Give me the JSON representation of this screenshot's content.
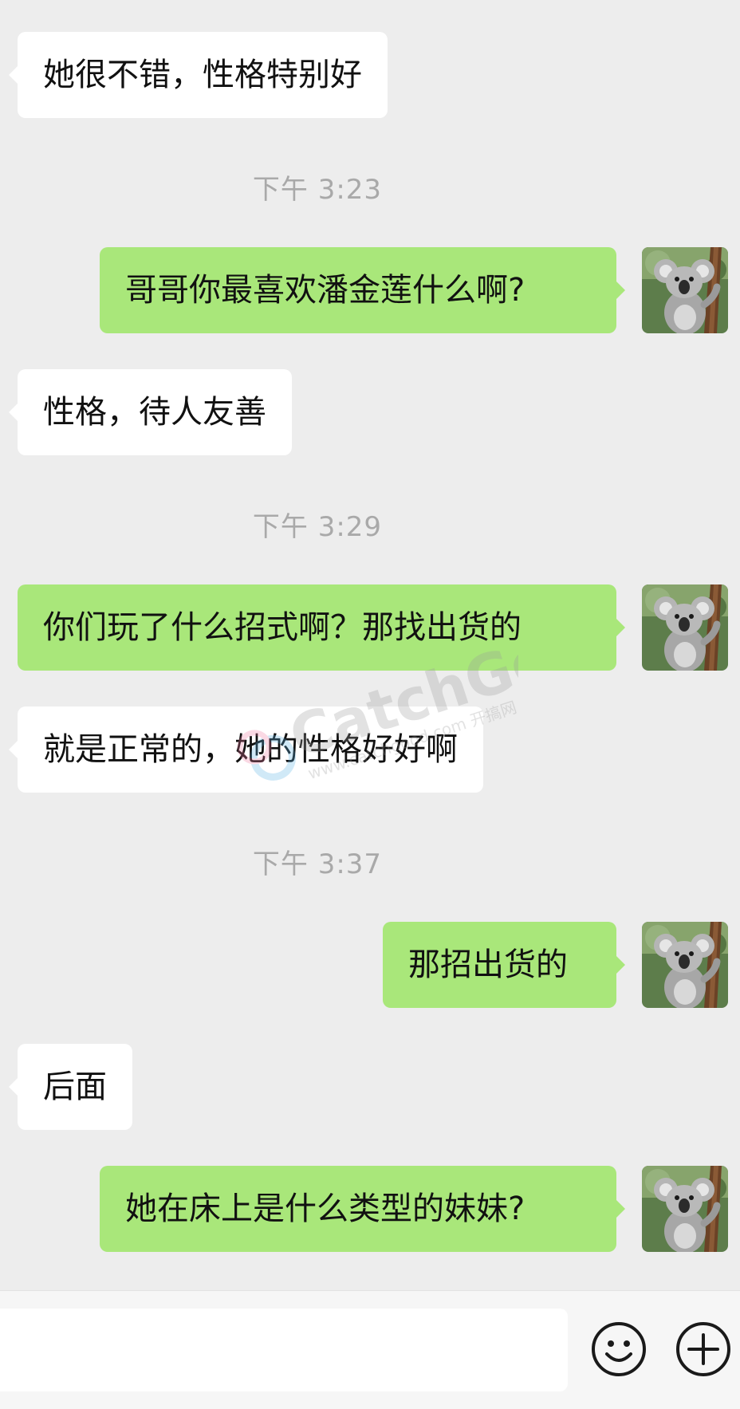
{
  "messages": [
    {
      "side": "left",
      "text": "她很不错，性格特别好"
    },
    {
      "timestamp": "下午 3:23"
    },
    {
      "side": "right",
      "text": "哥哥你最喜欢潘金莲什么啊?"
    },
    {
      "side": "left",
      "text": "性格，待人友善"
    },
    {
      "timestamp": "下午 3:29"
    },
    {
      "side": "right",
      "text": "你们玩了什么招式啊？那找出货的"
    },
    {
      "side": "left",
      "text": "就是正常的，她的性格好好啊"
    },
    {
      "timestamp": "下午 3:37"
    },
    {
      "side": "right",
      "text": "那招出货的"
    },
    {
      "side": "left",
      "text": "后面"
    },
    {
      "side": "right",
      "text": "她在床上是什么类型的妹妹?"
    }
  ],
  "watermark": {
    "brand": "CatchGoo",
    "site": "www.catchgood.com 开搞网"
  },
  "input_bar": {
    "value": "",
    "placeholder": ""
  },
  "icons": {
    "emoji": "smiley-icon",
    "more": "plus-icon",
    "avatar": "koala-avatar"
  },
  "colors": {
    "background": "#ededed",
    "bubble_left": "#ffffff",
    "bubble_right": "#a9e77a",
    "timestamp": "#a9a9a9",
    "bar": "#f6f6f6"
  }
}
